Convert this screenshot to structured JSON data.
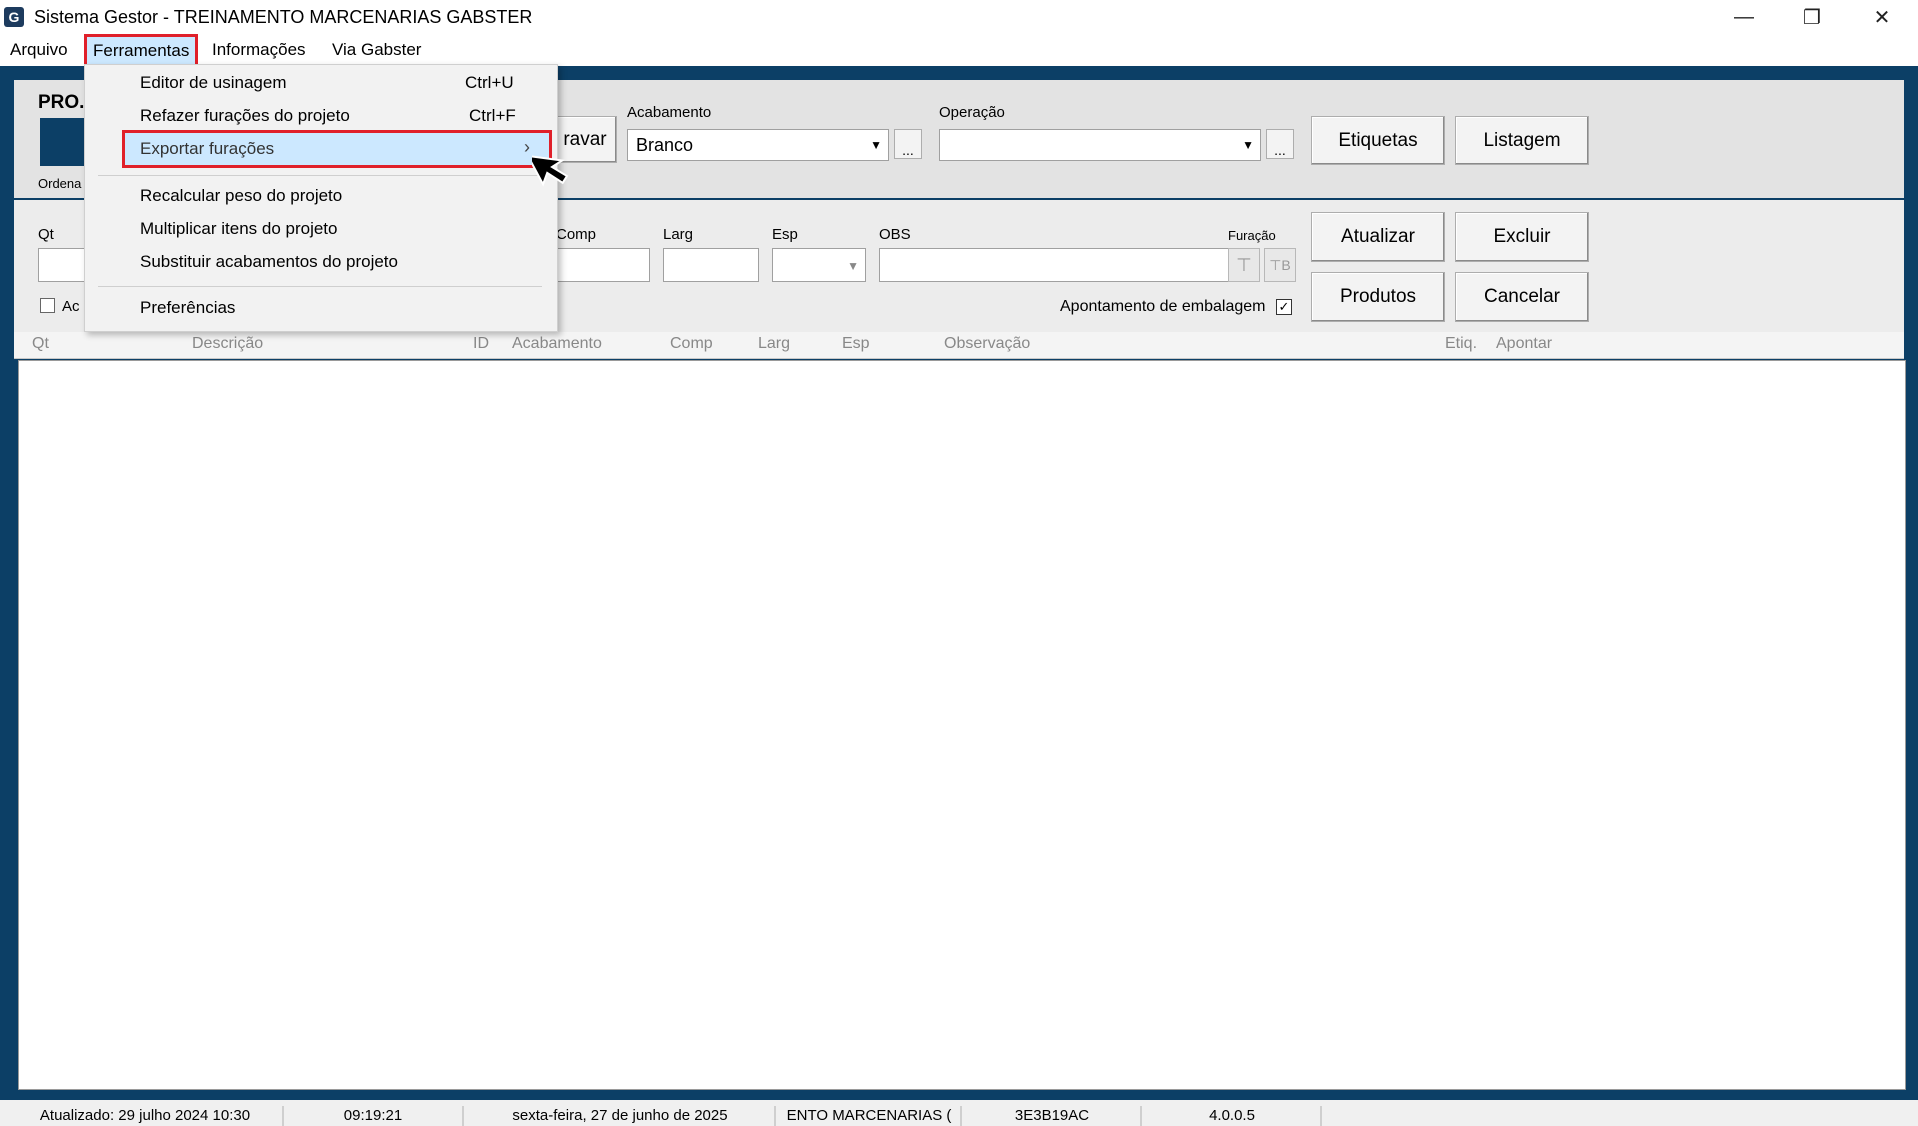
{
  "window": {
    "title": "Sistema Gestor - TREINAMENTO MARCENARIAS GABSTER",
    "icon": "app-logo-icon",
    "controls": {
      "minimize": "—",
      "maximize": "❐",
      "close": "✕"
    }
  },
  "menubar": {
    "items": [
      "Arquivo",
      "Ferramentas",
      "Informações",
      "Via Gabster"
    ]
  },
  "dropdown": {
    "items": [
      {
        "label": "Editor de usinagem",
        "shortcut": "Ctrl+U"
      },
      {
        "label": "Refazer furações do projeto",
        "shortcut": "Ctrl+F"
      },
      {
        "label": "Exportar furações",
        "submenu_arrow": "›"
      },
      {
        "label": "Recalcular peso do projeto"
      },
      {
        "label": "Multiplicar itens do projeto"
      },
      {
        "label": "Substituir acabamentos do projeto"
      },
      {
        "label": "Preferências"
      }
    ]
  },
  "top_panel": {
    "project_label": "PRO.",
    "ordena_label": "Ordena",
    "gravar_label": "ravar",
    "acabamento_label": "Acabamento",
    "acabamento_value": "Branco",
    "operacao_label": "Operação",
    "operacao_value": "",
    "dots": "...",
    "etiquetas": "Etiquetas",
    "listagem": "Listagem"
  },
  "mid_panel": {
    "qt_label": "Qt",
    "ac_label": "Ac",
    "comp_label": "Comp",
    "larg_label": "Larg",
    "esp_label": "Esp",
    "obs_label": "OBS",
    "furacao_label": "Furação",
    "apontamento_label": "Apontamento de embalagem",
    "atualizar": "Atualizar",
    "excluir": "Excluir",
    "produtos": "Produtos",
    "cancelar": "Cancelar"
  },
  "grid": {
    "columns": [
      "Qt",
      "Descrição",
      "ID",
      "Acabamento",
      "Comp",
      "Larg",
      "Esp",
      "Observação",
      "Etiq.",
      "Apontar"
    ],
    "rows": []
  },
  "statusbar": {
    "cells": [
      "Atualizado: 29 julho 2024 10:30",
      "09:19:21",
      "sexta-feira, 27 de junho de 2025",
      "ENTO MARCENARIAS (",
      "3E3B19AC",
      "4.0.0.5"
    ]
  },
  "colors": {
    "frame": "#0c3f66",
    "highlight": "#cce8ff",
    "annotation": "#e0202a"
  }
}
